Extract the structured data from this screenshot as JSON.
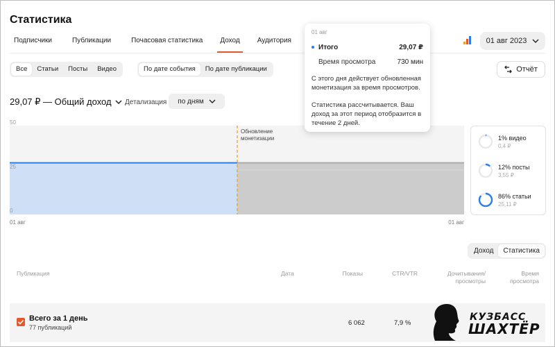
{
  "header": {
    "title": "Статистика"
  },
  "tabs": [
    {
      "label": "Подписчики",
      "active": false
    },
    {
      "label": "Публикации",
      "active": false
    },
    {
      "label": "Почасовая статистика",
      "active": false
    },
    {
      "label": "Доход",
      "active": true
    },
    {
      "label": "Аудитория",
      "active": false
    }
  ],
  "filters": {
    "content_types": [
      "Все",
      "Статьи",
      "Посты",
      "Видео"
    ],
    "content_active": "Все",
    "date_modes": [
      "По дате события",
      "По дате публикации"
    ],
    "date_mode_active": "По дате события"
  },
  "date_picker": {
    "value": "01 авг 2023"
  },
  "report_button": {
    "label": "Отчёт"
  },
  "summary": {
    "total_label": "29,07 ₽ — Общий доход",
    "detail_label": "Детализация",
    "detail_value": "по дням"
  },
  "tooltip": {
    "date": "01 авг",
    "total_label": "Итого",
    "total_value": "29,07 ₽",
    "watch_label": "Время просмотра",
    "watch_value": "730 мин",
    "note1": "С этого дня действует обновленная монетизация за время просмотров.",
    "note2": "Статистика рассчитывается. Ваш доход за этот период отобразится в течение 2 дней."
  },
  "chart_data": {
    "type": "area",
    "y_ticks": [
      "50",
      "25",
      "0"
    ],
    "ylim": [
      0,
      50
    ],
    "x_labels": [
      "01 авг",
      "01 авг"
    ],
    "series": [
      {
        "values": [
          29.07,
          29.07
        ]
      }
    ],
    "annotation": "Обновление монетизации",
    "colors": {
      "line": "#2b7de9",
      "fill": "#cfe0f6",
      "pending": "#cccccc",
      "marker": "#f0a020"
    }
  },
  "breakdown": [
    {
      "pct": "1%",
      "name": "видео",
      "value": "0,4 ₽",
      "fraction": 0.01
    },
    {
      "pct": "12%",
      "name": "посты",
      "value": "3,55 ₽",
      "fraction": 0.12
    },
    {
      "pct": "86%",
      "name": "статьи",
      "value": "25,11 ₽",
      "fraction": 0.86
    }
  ],
  "table_toggle": {
    "options": [
      "Доход",
      "Статистика"
    ],
    "active": "Статистика"
  },
  "table": {
    "headers": {
      "publication": "Публикация",
      "date": "Дата",
      "views": "Показы",
      "ctr": "CTR/VTR",
      "readthrough_1": "Дочитывания/",
      "readthrough_2": "просмотры",
      "watch_1": "Время",
      "watch_2": "просмотра"
    },
    "total_row": {
      "title": "Всего за 1 день",
      "subtitle": "77 публикаций",
      "views": "6 062",
      "ctr": "7,9 %"
    }
  },
  "logo": {
    "line1": "КУЗБАСС",
    "line2": "ШАХТЁР"
  },
  "colors": {
    "accent": "#e05a2b",
    "blue": "#2b7de9",
    "chip_bg": "#efefef"
  }
}
